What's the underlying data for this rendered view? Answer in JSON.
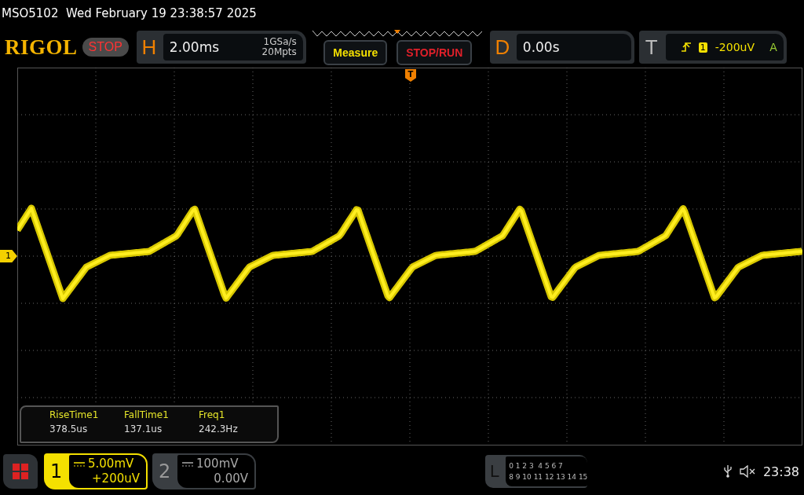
{
  "title_bar": {
    "text": "MSO5102  Wed February 19 23:38:57 2025"
  },
  "logo": "RIGOL",
  "run_state": {
    "label": "STOP",
    "running": false
  },
  "horizontal": {
    "label": "H",
    "timebase": "2.00ms",
    "sample_rate": "1GSa/s",
    "memory_depth": "20Mpts"
  },
  "buttons": [
    {
      "label": "Measure",
      "kind": "measure"
    },
    {
      "label": "STOP/RUN",
      "kind": "run"
    }
  ],
  "delay": {
    "label": "D",
    "value": "0.00s"
  },
  "trigger": {
    "label": "T",
    "source": "1",
    "threshold": "-200uV",
    "mode": "A"
  },
  "screen": {
    "channel_marker": "1",
    "trigger_marker": "T"
  },
  "measurements": [
    {
      "name": "RiseTime1",
      "value": "378.5us"
    },
    {
      "name": "FallTime1",
      "value": "137.1us"
    },
    {
      "name": "Freq1",
      "value": "242.3Hz"
    }
  ],
  "channels": [
    {
      "number": "1",
      "selected": true,
      "scale": "5.00mV",
      "offset": "+200uV"
    },
    {
      "number": "2",
      "selected": false,
      "scale": "100mV",
      "offset": "0.00V"
    }
  ],
  "logic": {
    "label": "L",
    "rows": [
      "0 1 2 3  4 5 6 7",
      "8 9 10 11 12 13 14 15"
    ]
  },
  "status": {
    "time": "23:38"
  }
}
